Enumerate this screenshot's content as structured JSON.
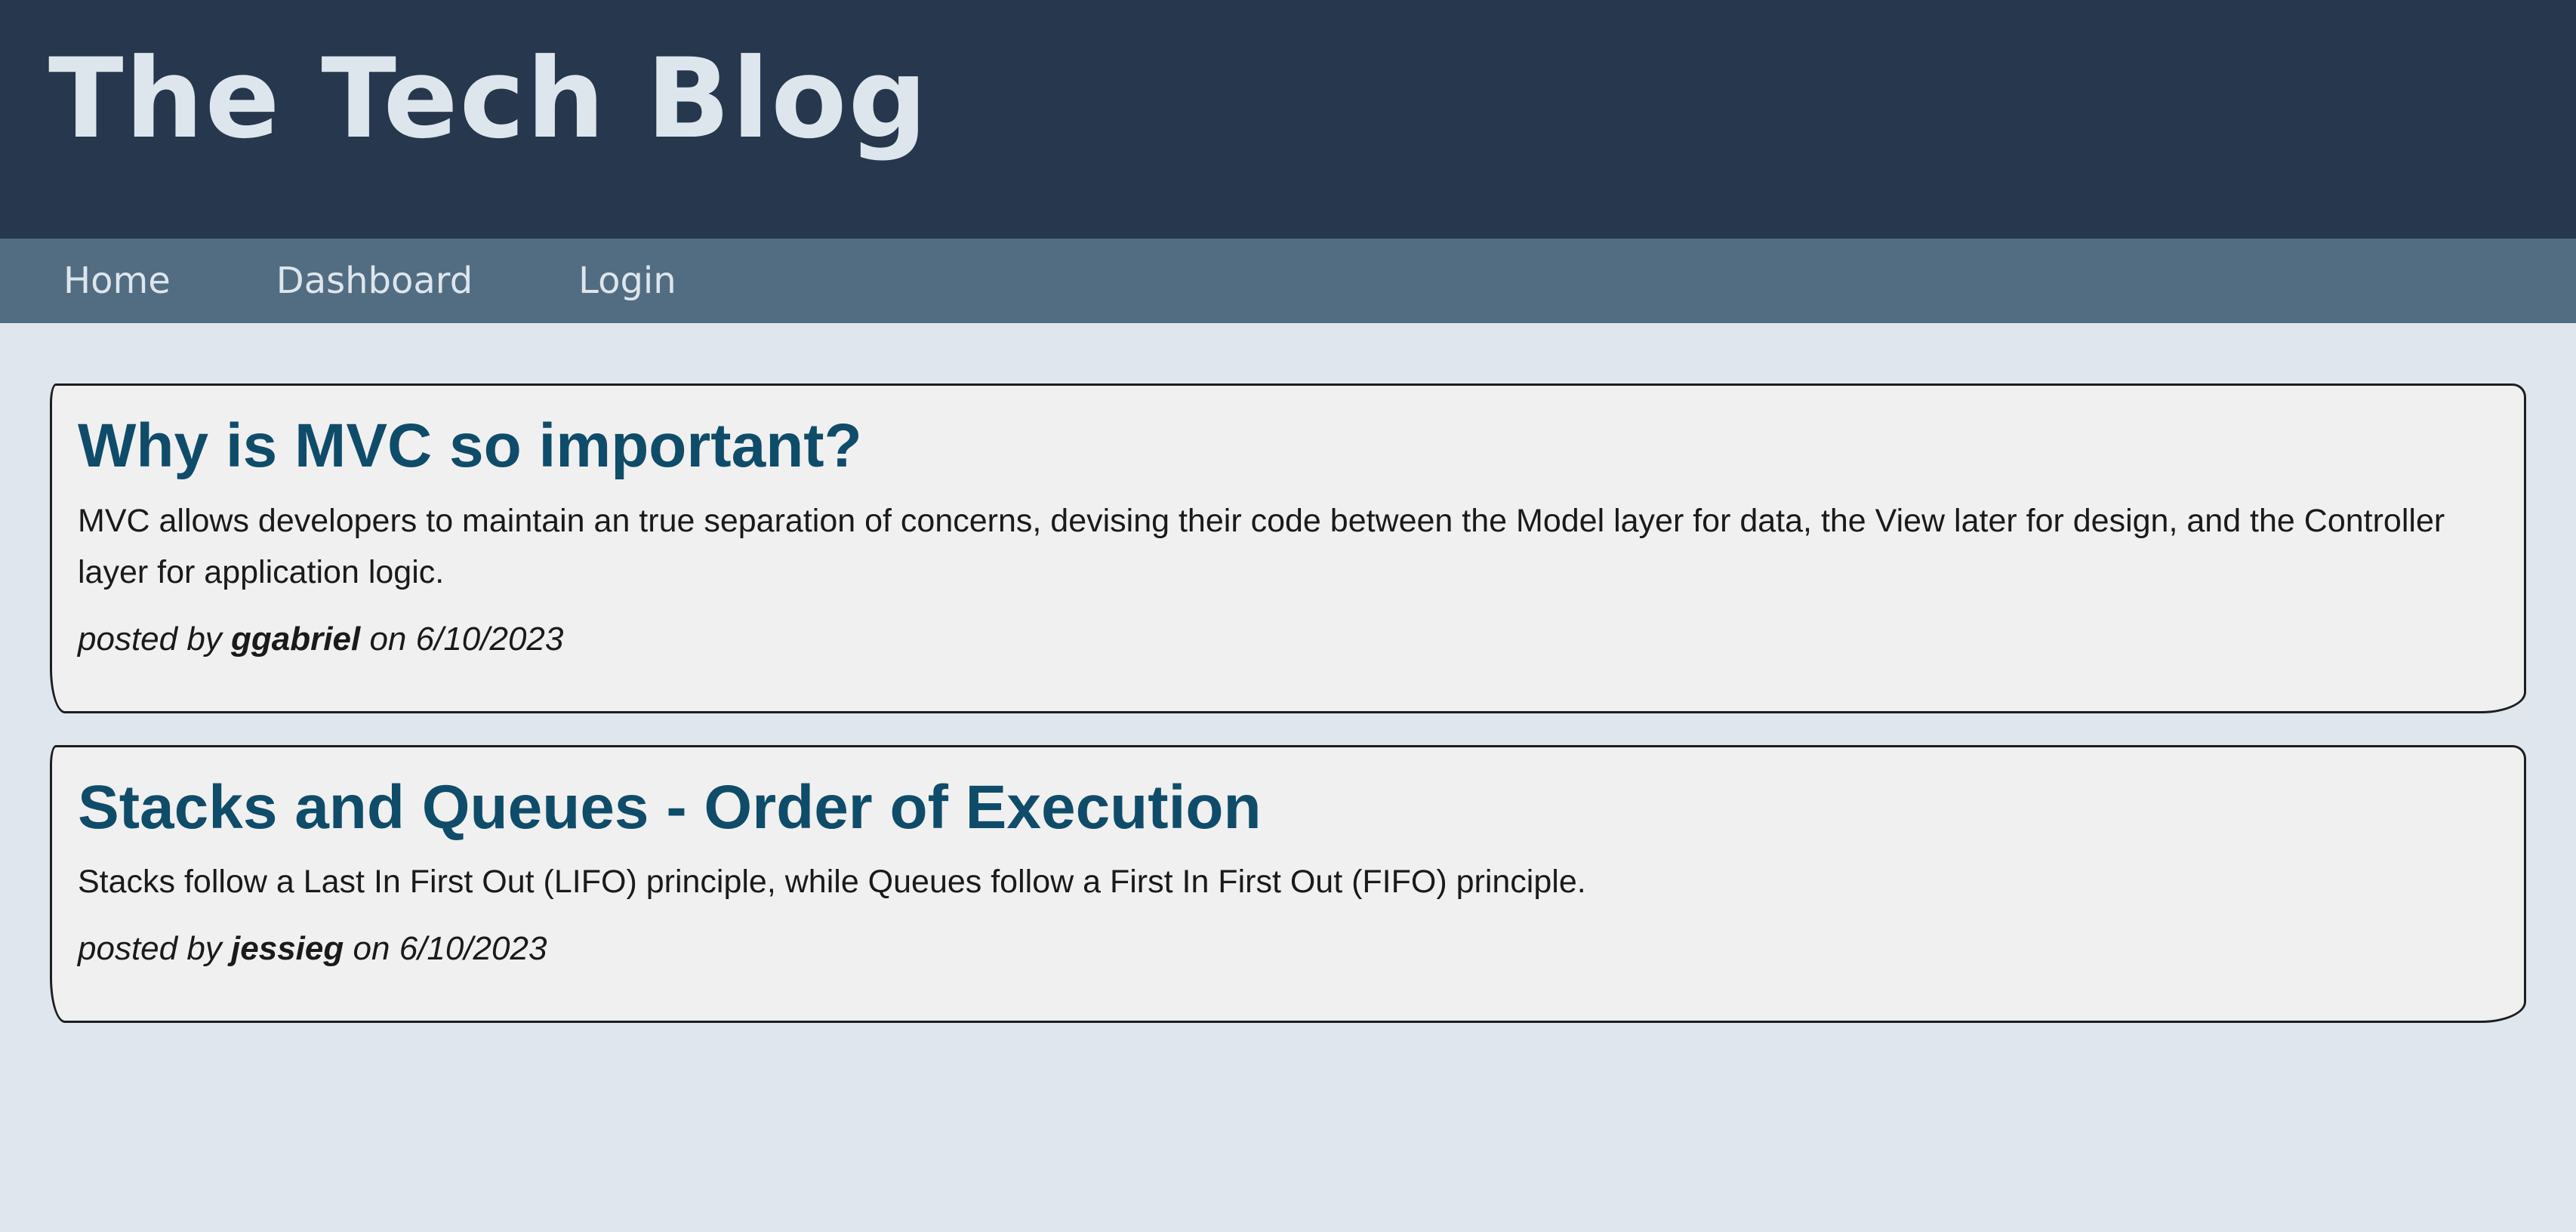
{
  "header": {
    "title": "The Tech Blog"
  },
  "nav": {
    "items": [
      {
        "label": "Home"
      },
      {
        "label": "Dashboard"
      },
      {
        "label": "Login"
      }
    ]
  },
  "posts": [
    {
      "title": "Why is MVC so important?",
      "body": "MVC allows developers to maintain an true separation of concerns, devising their code between the Model layer for data, the View later for design, and the Controller layer for application logic.",
      "posted_by_prefix": "posted by",
      "author": "ggabriel",
      "on_word": "on",
      "date": "6/10/2023"
    },
    {
      "title": "Stacks and Queues - Order of Execution",
      "body": "Stacks follow a Last In First Out (LIFO) principle, while Queues follow a First In First Out (FIFO) principle.",
      "posted_by_prefix": "posted by",
      "author": "jessieg",
      "on_word": "on",
      "date": "6/10/2023"
    }
  ],
  "colors": {
    "header_bg": "#27374d",
    "nav_bg": "#526d82",
    "page_bg": "#dfe6ed",
    "title_text": "#dde6ed",
    "post_title": "#0f4c69",
    "card_bg": "#f0f0f0"
  }
}
